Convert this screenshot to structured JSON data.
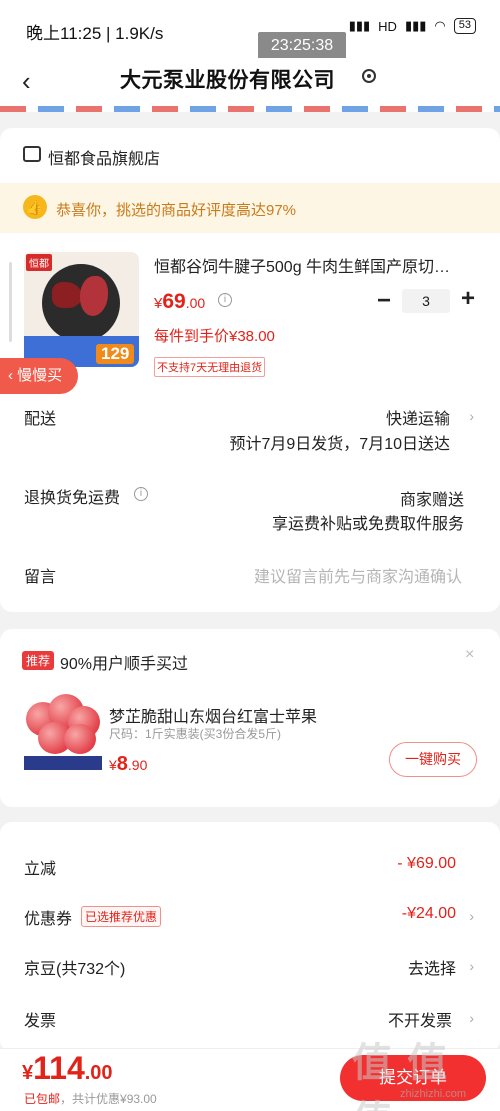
{
  "status_bar": {
    "left_text": "晚上11:25 | 1.9K/s",
    "network": "HD",
    "battery": "53",
    "time_overlay": "23:25:38"
  },
  "header": {
    "title": "大元泵业股份有限公司"
  },
  "shop": {
    "name": "恒都食品旗舰店",
    "praise": "恭喜你，挑选的商品好评度高达97%"
  },
  "product": {
    "brand_logo": "恒都",
    "image_price": "129",
    "name": "恒都谷饲牛腱子500g   牛肉生鲜国产原切…",
    "price_symbol": "¥",
    "price_int": "69",
    "price_dec": ".00",
    "unit_price": "每件到手价¥38.00",
    "quantity": "3",
    "no_return": "不支持7天无理由退货"
  },
  "slow_buy": "慢慢买",
  "delivery": {
    "label": "配送",
    "value": "快递运输",
    "sub": "预计7月9日发货，7月10日送达"
  },
  "return_shipping": {
    "label": "退换货免运费",
    "value": "商家赠送",
    "sub": "享运费补贴或免费取件服务"
  },
  "note": {
    "label": "留言",
    "placeholder": "建议留言前先与商家沟通确认"
  },
  "recommend": {
    "badge": "推荐",
    "title": "90%用户顺手买过",
    "close": "×",
    "item_name": "梦芷脆甜山东烟台红富士苹果",
    "item_spec": "尺码：1斤实惠装(买3份合发5斤)",
    "price_symbol": "¥",
    "price_int": "8",
    "price_dec": ".90",
    "buy_label": "一键购买"
  },
  "summary": {
    "discount_label": "立减",
    "discount_value": "- ¥69.00",
    "coupon_label": "优惠券",
    "coupon_tag": "已选推荐优惠",
    "coupon_value": "-¥24.00",
    "jingdou_label": "京豆(共732个)",
    "jingdou_value": "去选择",
    "invoice_label": "发票",
    "invoice_value": "不开发票"
  },
  "footer": {
    "total_symbol": "¥",
    "total_int": "114",
    "total_dec": ".00",
    "shipping": "已包邮",
    "savings": "，共计优惠¥93.00",
    "submit": "提交订单",
    "watermark": "值 值 值",
    "watermark_sub": "zhizhizhi.com"
  },
  "colors": {
    "accent": "#e2231a",
    "submit_bg": "#f23030",
    "praise_bg": "#fdf6e4"
  }
}
